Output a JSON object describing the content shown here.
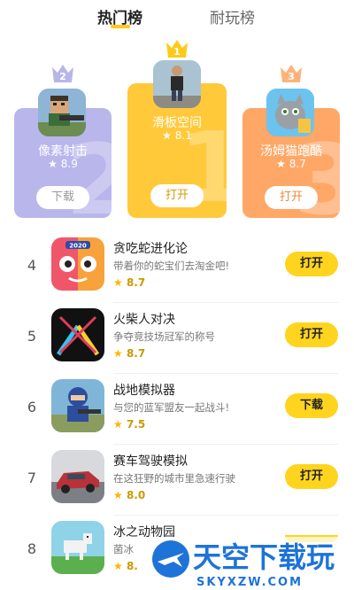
{
  "tabs": {
    "active": "热门榜",
    "inactive": "耐玩榜"
  },
  "colors": {
    "accent": "#FFC91A",
    "button": "#FFD41F",
    "rating": "#C99A00"
  },
  "podium": [
    {
      "rank": "2",
      "title": "像素射击",
      "rating": "★ 8.9",
      "button": "下载",
      "big_number": "2"
    },
    {
      "rank": "1",
      "title": "滑板空间",
      "rating": "★ 8.1",
      "button": "打开",
      "big_number": "1"
    },
    {
      "rank": "3",
      "title": "汤姆猫跑酷",
      "rating": "★ 8.7",
      "button": "打开",
      "big_number": "3"
    }
  ],
  "list": [
    {
      "rank": "4",
      "title": "贪吃蛇进化论",
      "desc": "带着你的蛇宝们去淘金吧!",
      "rating": "8.7",
      "button": "打开"
    },
    {
      "rank": "5",
      "title": "火柴人对决",
      "desc": "争夺竞技场冠军的称号",
      "rating": "8.7",
      "button": "打开"
    },
    {
      "rank": "6",
      "title": "战地模拟器",
      "desc": "与您的蓝军盟友一起战斗!",
      "rating": "7.5",
      "button": "下载"
    },
    {
      "rank": "7",
      "title": "赛车驾驶模拟",
      "desc": "在这狂野的城市里急速行驶",
      "rating": "8.0",
      "button": "打开"
    },
    {
      "rank": "8",
      "title": "冰之动物园",
      "desc": "菌冰",
      "rating": "8.",
      "button": ""
    }
  ],
  "watermark": {
    "main": "天空下载玩",
    "sub": "SKYXZW.COM"
  }
}
